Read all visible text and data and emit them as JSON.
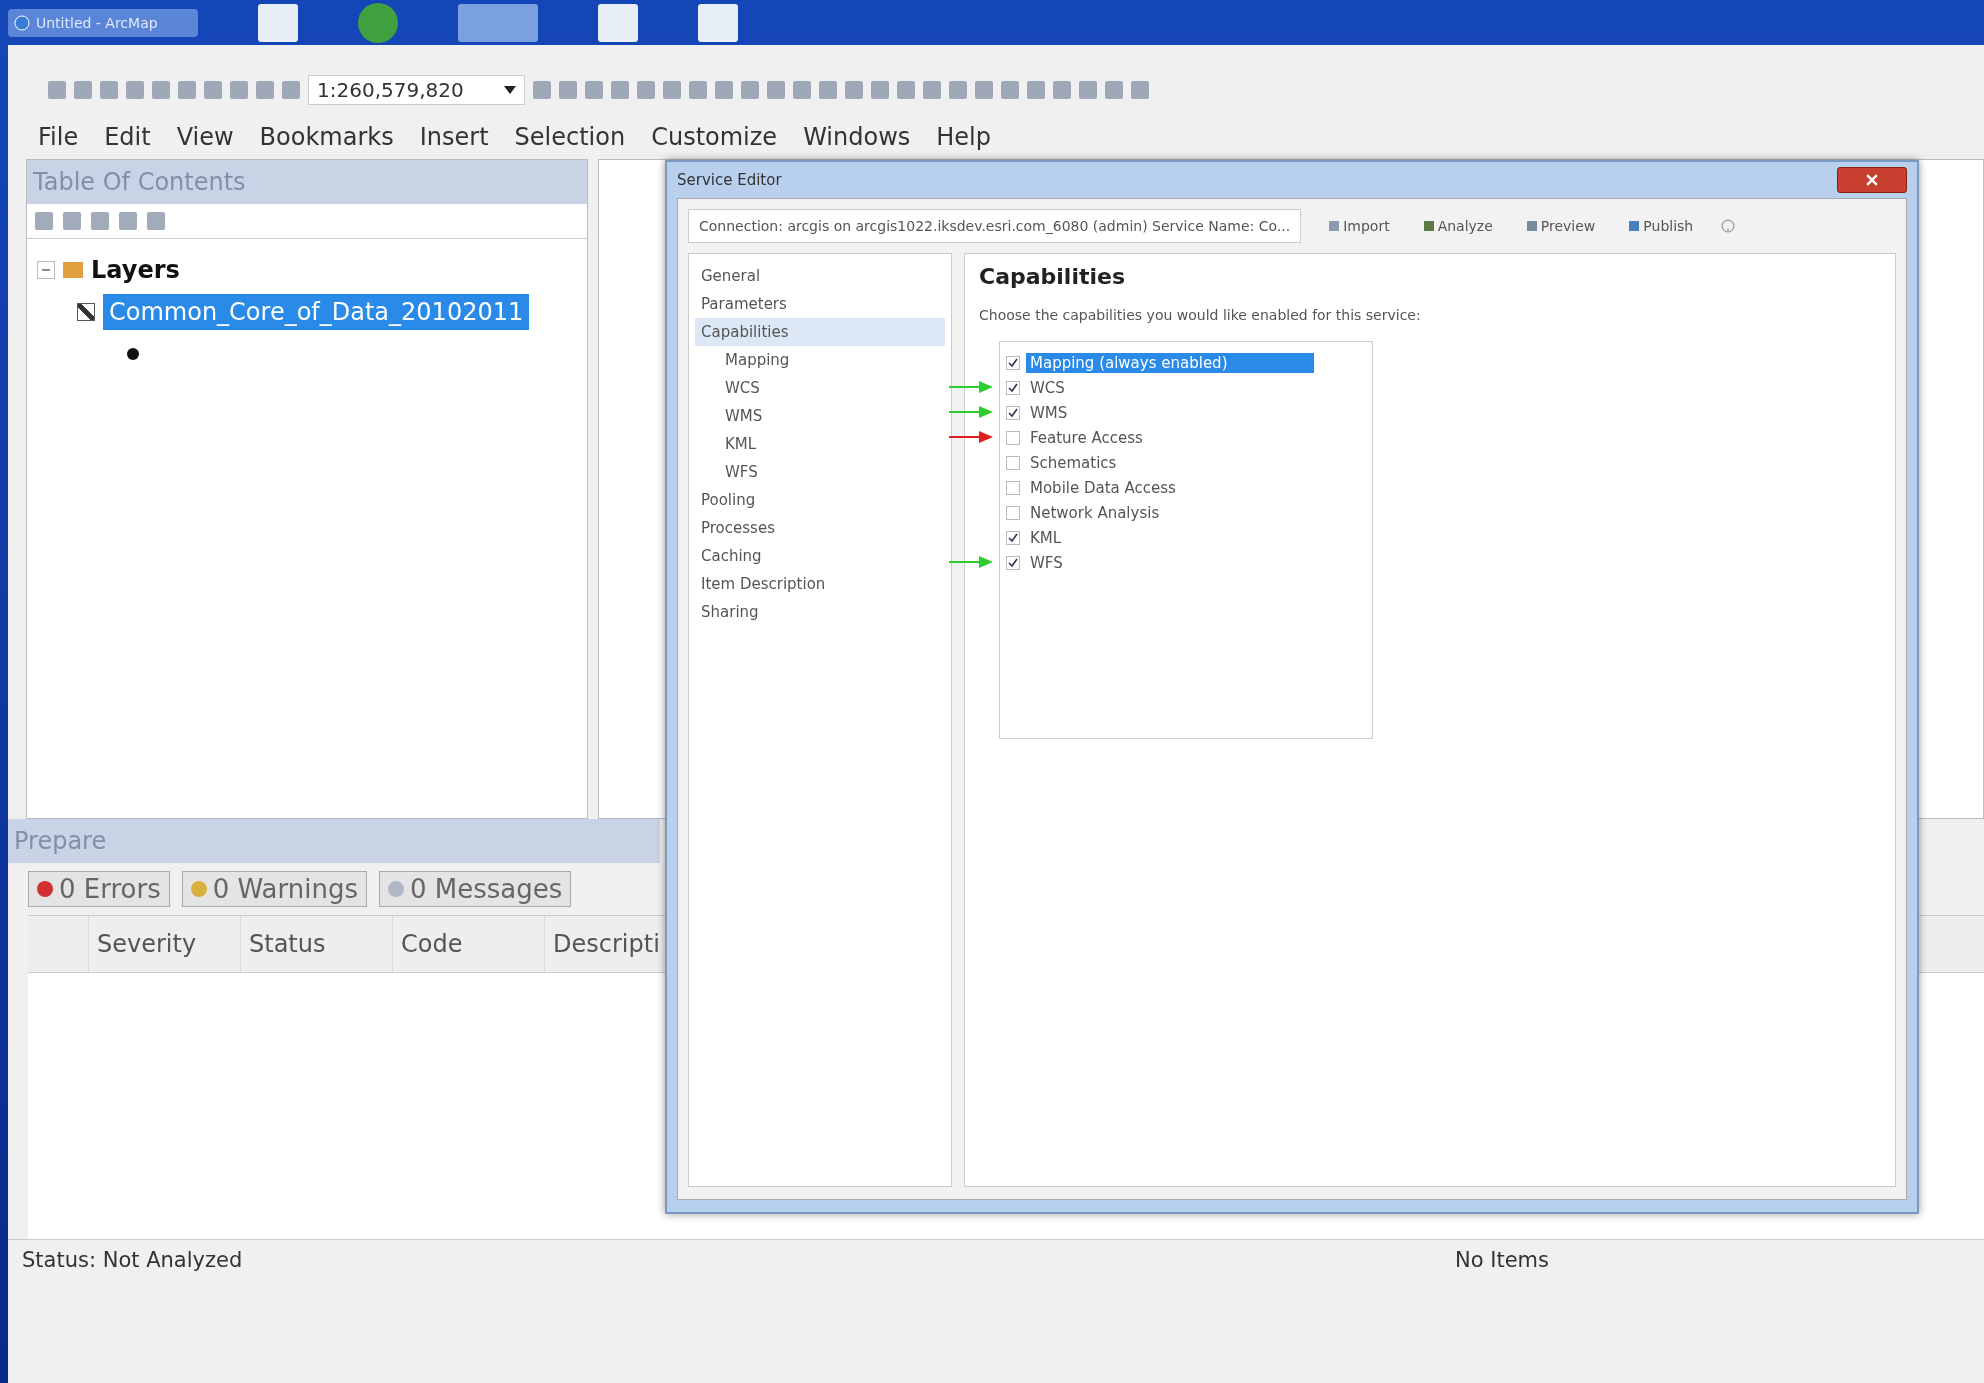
{
  "taskbar": {
    "title": "Untitled - ArcMap"
  },
  "toolbar": {
    "scale": "1:260,579,820"
  },
  "menu": [
    "File",
    "Edit",
    "View",
    "Bookmarks",
    "Insert",
    "Selection",
    "Customize",
    "Windows",
    "Help"
  ],
  "toc": {
    "title": "Table Of Contents",
    "root": {
      "label": "Layers",
      "expanded": true,
      "children": [
        {
          "label": "Common_Core_of_Data_20102011",
          "checked": true,
          "selected": true
        }
      ]
    }
  },
  "prepare": {
    "title": "Prepare",
    "filters": [
      {
        "kind": "error",
        "label": "0 Errors"
      },
      {
        "kind": "warning",
        "label": "0 Warnings"
      },
      {
        "kind": "message",
        "label": "0 Messages"
      }
    ],
    "columns": [
      "Severity",
      "Status",
      "Code",
      "Descripti"
    ]
  },
  "status_bar": {
    "status": "Status: Not Analyzed",
    "items": "No Items"
  },
  "dialog": {
    "title": "Service Editor",
    "connection": "Connection: arcgis on arcgis1022.iksdev.esri.com_6080 (admin)   Service Name: Co...",
    "actions": [
      {
        "kind": "import",
        "label": "Import"
      },
      {
        "kind": "analyze",
        "label": "Analyze"
      },
      {
        "kind": "preview",
        "label": "Preview"
      },
      {
        "kind": "publish",
        "label": "Publish"
      }
    ],
    "nav": [
      {
        "label": "General",
        "selected": false
      },
      {
        "label": "Parameters",
        "selected": false
      },
      {
        "label": "Capabilities",
        "selected": true,
        "children": [
          {
            "label": "Mapping",
            "selected": false
          },
          {
            "label": "WCS",
            "selected": false
          },
          {
            "label": "WMS",
            "selected": false
          },
          {
            "label": "KML",
            "selected": false
          },
          {
            "label": "WFS",
            "selected": false
          }
        ]
      },
      {
        "label": "Pooling",
        "selected": false
      },
      {
        "label": "Processes",
        "selected": false
      },
      {
        "label": "Caching",
        "selected": false
      },
      {
        "label": "Item Description",
        "selected": false
      },
      {
        "label": "Sharing",
        "selected": false
      }
    ],
    "heading": "Capabilities",
    "hint": "Choose the capabilities you would like enabled for this service:",
    "capabilities": [
      {
        "label": "Mapping (always enabled)",
        "checked": true,
        "selected": true
      },
      {
        "label": "WCS",
        "checked": true,
        "selected": false,
        "arrow": {
          "color": "#2ecc2e"
        }
      },
      {
        "label": "WMS",
        "checked": true,
        "selected": false,
        "arrow": {
          "color": "#2ecc2e"
        }
      },
      {
        "label": "Feature Access",
        "checked": false,
        "selected": false,
        "arrow": {
          "color": "#e02020"
        }
      },
      {
        "label": "Schematics",
        "checked": false,
        "selected": false
      },
      {
        "label": "Mobile Data Access",
        "checked": false,
        "selected": false
      },
      {
        "label": "Network Analysis",
        "checked": false,
        "selected": false
      },
      {
        "label": "KML",
        "checked": true,
        "selected": false
      },
      {
        "label": "WFS",
        "checked": true,
        "selected": false,
        "arrow": {
          "color": "#2ecc2e"
        }
      }
    ]
  }
}
